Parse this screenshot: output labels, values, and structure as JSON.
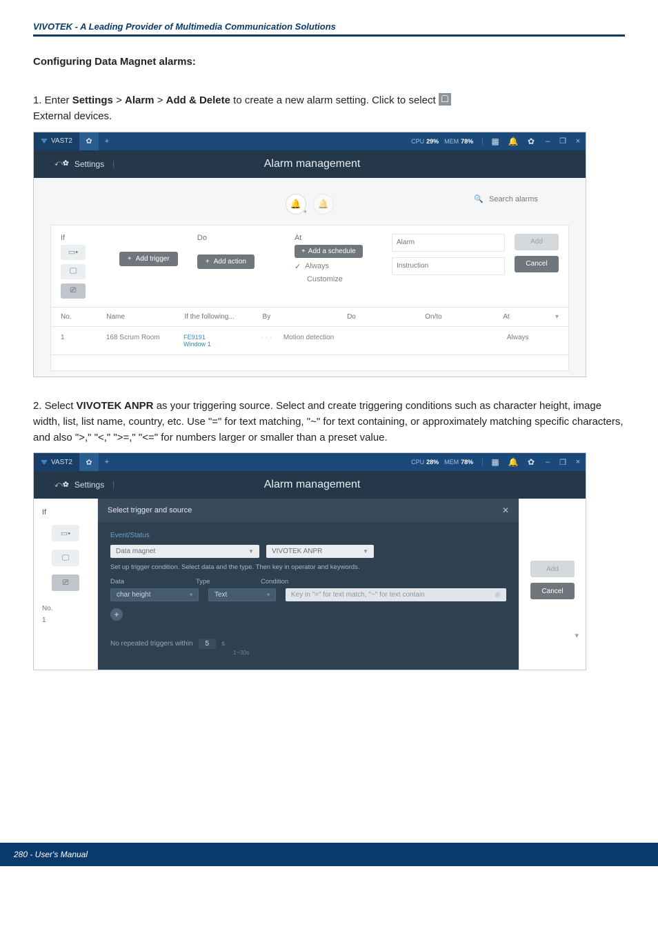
{
  "header": {
    "brand_tagline": "VIVOTEK - A Leading Provider of Multimedia Communication Solutions"
  },
  "section": {
    "title": "Configuring Data Magnet alarms:"
  },
  "step1": {
    "prefix": "1. Enter ",
    "s_settings": "Settings",
    "gt1": " > ",
    "s_alarm": "Alarm",
    "gt2": " > ",
    "s_add_delete": "Add & Delete",
    "mid": " to create a new alarm setting. Click to select ",
    "tail": "External devices."
  },
  "step2": {
    "prefix": "2. Select ",
    "bold": "VIVOTEK ANPR",
    "body": " as your triggering source. Select and create triggering conditions such as character height, image width, list, list name, country, etc. Use \"=\" for text matching, \"~\" for text containing, or approximately matching specific characters, and also \">,\" \"<,\" \">=,\" \"<=\" for numbers larger or smaller than a preset value."
  },
  "shot1": {
    "app_name": "VAST2",
    "cpu_label": "CPU",
    "cpu_val": "29%",
    "mem_label": "MEM",
    "mem_val": "78%",
    "crumb_settings": "Settings",
    "page_title": "Alarm management",
    "search_placeholder": "Search alarms",
    "col_if": "If",
    "col_do": "Do",
    "col_at": "At",
    "btn_add_trigger": "Add trigger",
    "btn_add_action": "Add action",
    "btn_add_schedule": "Add a schedule",
    "opt_always": "Always",
    "opt_customize": "Customize",
    "alarm_placeholder": "Alarm",
    "instr_placeholder": "Instruction",
    "btn_add": "Add",
    "btn_cancel": "Cancel",
    "hdr_no": "No.",
    "hdr_name": "Name",
    "hdr_if": "If the following...",
    "hdr_by": "By",
    "hdr_do": "Do",
    "hdr_onto": "On/to",
    "hdr_at": "At",
    "row_no": "1",
    "row_name": "168 Scrum Room",
    "row_cam": "FE9191",
    "row_win": "Window 1",
    "row_dots": "· · ·",
    "row_by": "Motion detection",
    "row_at": "Always"
  },
  "shot2": {
    "app_name": "VAST2",
    "cpu_label": "CPU",
    "cpu_val": "28%",
    "mem_label": "MEM",
    "mem_val": "78%",
    "crumb_settings": "Settings",
    "page_title": "Alarm management",
    "panel_title": "Select trigger and source",
    "grp_label": "Event/Status",
    "sel_category": "Data magnet",
    "sel_source": "VIVOTEK ANPR",
    "help_text": "Set up trigger condition. Select data and the type. Then key in operator and keywords.",
    "th_data": "Data",
    "th_type": "Type",
    "th_cond": "Condition",
    "row_data": "char height",
    "row_type": "Text",
    "cond_placeholder": "Key in \"=\" for text match, \"~\" for text contain",
    "norepeat_label": "No repeated triggers within",
    "norepeat_val": "5",
    "norepeat_unit": "s",
    "norepeat_range": "1~30s",
    "if_label": "If",
    "no_label": "No.",
    "row1": "1",
    "btn_cancel": "Cancel",
    "btn_add": "Add"
  },
  "footer": {
    "text": "280 - User's Manual"
  }
}
